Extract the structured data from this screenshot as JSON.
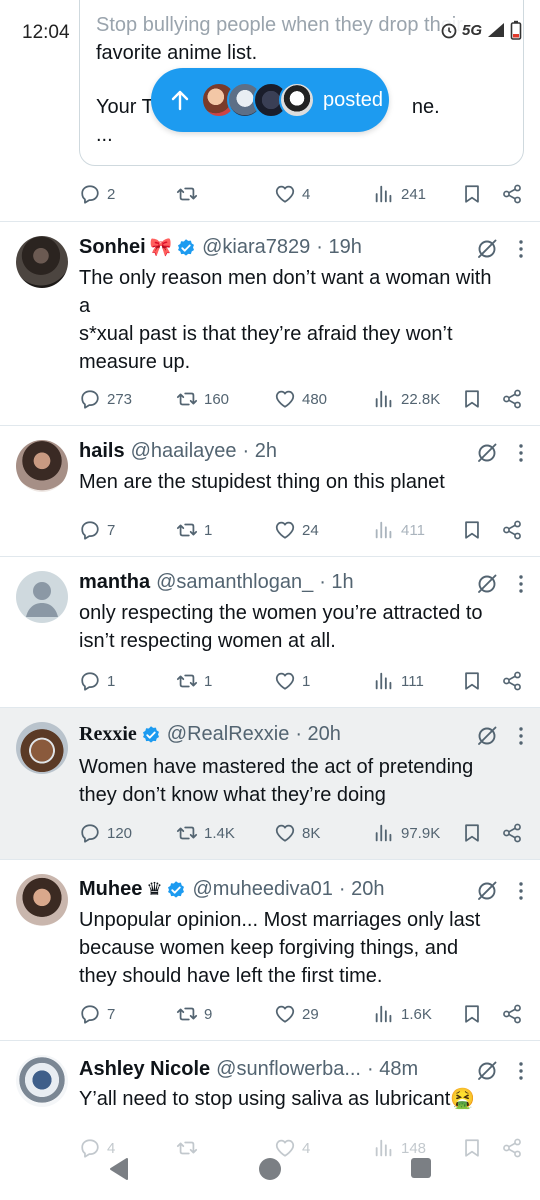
{
  "status_bar": {
    "time": "12:04",
    "network": "5G"
  },
  "quote": {
    "line1": "Stop bullying people when they drop their",
    "line2": "favorite anime list.",
    "line3": "Your T",
    "line3_end": "ne.",
    "line4": "..."
  },
  "pill": {
    "label": "posted"
  },
  "top_actions": {
    "replies": "2",
    "reposts": "",
    "likes": "4",
    "views": "241"
  },
  "tweets": [
    {
      "name": "Sonhei",
      "emoji": "🎀",
      "verified": true,
      "handle": "@kiara7829",
      "time": "· 19h",
      "lines": [
        "The only reason men don’t want a woman with",
        "a",
        "s*xual past is that they’re afraid they won’t",
        "measure up."
      ],
      "replies": "273",
      "reposts": "160",
      "likes": "480",
      "views": "22.8K"
    },
    {
      "name": "hails",
      "emoji": "",
      "verified": false,
      "handle": "@haailayee",
      "time": "· 2h",
      "lines": [
        "Men are the stupidest thing on this planet"
      ],
      "replies": "7",
      "reposts": "1",
      "likes": "24",
      "views": "411"
    },
    {
      "name": "mantha",
      "emoji": "",
      "verified": false,
      "handle": "@samanthlogan_",
      "time": "· 1h",
      "lines": [
        "only respecting the women you’re attracted to",
        "isn’t respecting women at all."
      ],
      "replies": "1",
      "reposts": "1",
      "likes": "1",
      "views": "111"
    },
    {
      "name": "Rexxie",
      "emoji": "",
      "verified": true,
      "handle": "@RealRexxie",
      "time": "· 20h",
      "lines": [
        "Women have mastered the act of pretending",
        "they don’t know what they’re doing"
      ],
      "replies": "120",
      "reposts": "1.4K",
      "likes": "8K",
      "views": "97.9K"
    },
    {
      "name": "Muhee",
      "emoji": "♛",
      "verified": true,
      "handle": "@muheediva01",
      "time": "· 20h",
      "lines": [
        "Unpopular opinion... Most marriages only last",
        "because women keep forgiving things, and",
        "they should have left the first time."
      ],
      "replies": "7",
      "reposts": "9",
      "likes": "29",
      "views": "1.6K"
    },
    {
      "name": "Ashley Nicole",
      "emoji": "",
      "verified": false,
      "handle": "@sunflowerba...",
      "time": "· 48m",
      "lines": [
        "Y’all need to stop using saliva as lubricant🤮"
      ],
      "replies": "4",
      "reposts": "",
      "likes": "4",
      "views": "148"
    }
  ],
  "colors": {
    "accent": "#1d9bf0",
    "text": "#0f1419",
    "muted": "#536471",
    "divider": "#e1e8ed",
    "highlight": "#eef0f1"
  }
}
